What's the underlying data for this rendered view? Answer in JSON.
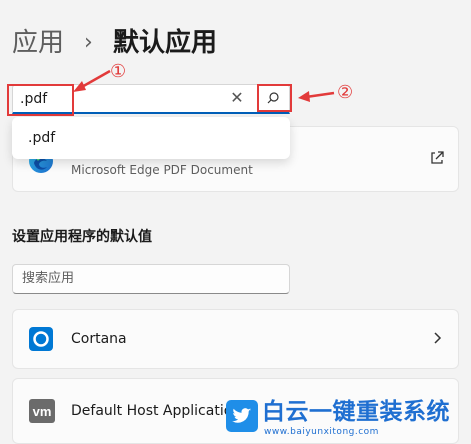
{
  "breadcrumb": {
    "parent": "应用",
    "separator": "›",
    "current": "默认应用"
  },
  "file_search": {
    "value": ".pdf",
    "clear_glyph": "✕",
    "search_icon": "search-icon"
  },
  "suggestions": [
    {
      "label": ".pdf"
    }
  ],
  "pdf_default": {
    "description": "Microsoft Edge PDF Document",
    "icon": "edge-icon",
    "action_icon": "external-link-icon"
  },
  "section": {
    "title": "设置应用程序的默认值"
  },
  "app_search": {
    "placeholder": "搜索应用"
  },
  "apps": [
    {
      "name": "Cortana",
      "icon": "cortana-icon"
    },
    {
      "name": "Default Host Application",
      "icon": "vm-icon",
      "icon_text": "vm"
    }
  ],
  "annotations": {
    "marker_1": "①",
    "marker_2": "②",
    "color": "#e23a3a"
  },
  "watermark": {
    "text": "白云一键重装系统",
    "url": "www.baiyunxitong.com"
  },
  "colors": {
    "accent": "#005fb8",
    "background": "#f3f3f3",
    "watermark": "#1f6fd1"
  }
}
